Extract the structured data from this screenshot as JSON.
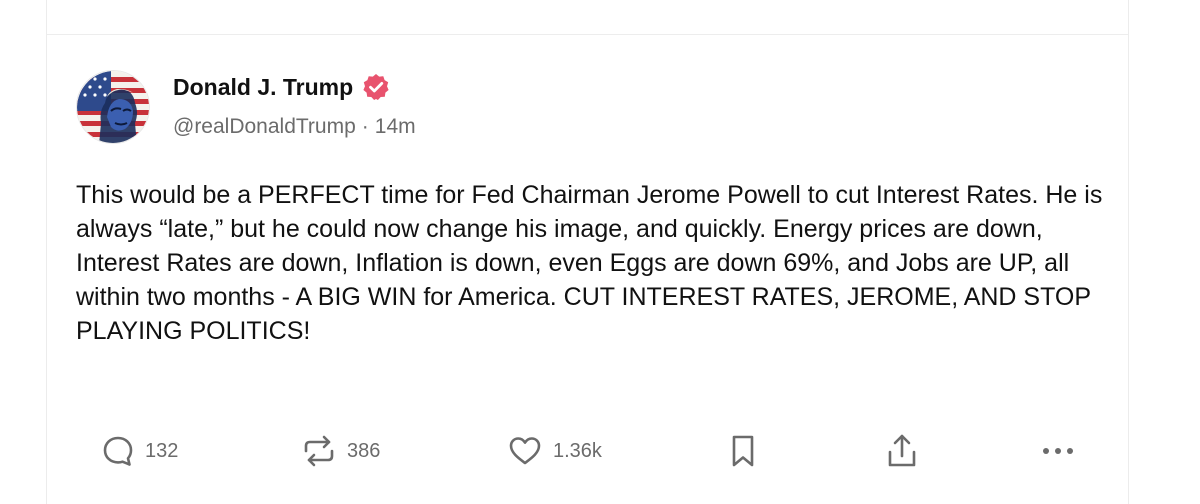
{
  "post": {
    "author": {
      "display_name": "Donald J. Trump",
      "verified": true,
      "handle": "@realDonaldTrump",
      "separator": "·",
      "time_ago": "14m"
    },
    "text": "This would be a PERFECT time for Fed Chairman Jerome Powell to cut Interest Rates. He is always “late,” but he could now change his image, and quickly. Energy prices are down, Interest Rates are down, Inflation is down, even Eggs are down 69%, and Jobs are UP, all within two months - A BIG WIN for America. CUT INTEREST RATES, JEROME, AND STOP PLAYING POLITICS!",
    "actions": {
      "replies": "132",
      "reposts": "386",
      "likes": "1.36k"
    }
  },
  "icons": {
    "verified": "verified-badge-icon",
    "reply": "speech-bubble-icon",
    "repost": "repost-arrows-icon",
    "like": "heart-icon",
    "bookmark": "bookmark-icon",
    "share": "share-icon",
    "more": "ellipsis-icon"
  },
  "colors": {
    "verified_badge": "#E8536E",
    "icon_gray": "#6B6B6B",
    "text": "#111111",
    "secondary_text": "#6B6B6B"
  }
}
